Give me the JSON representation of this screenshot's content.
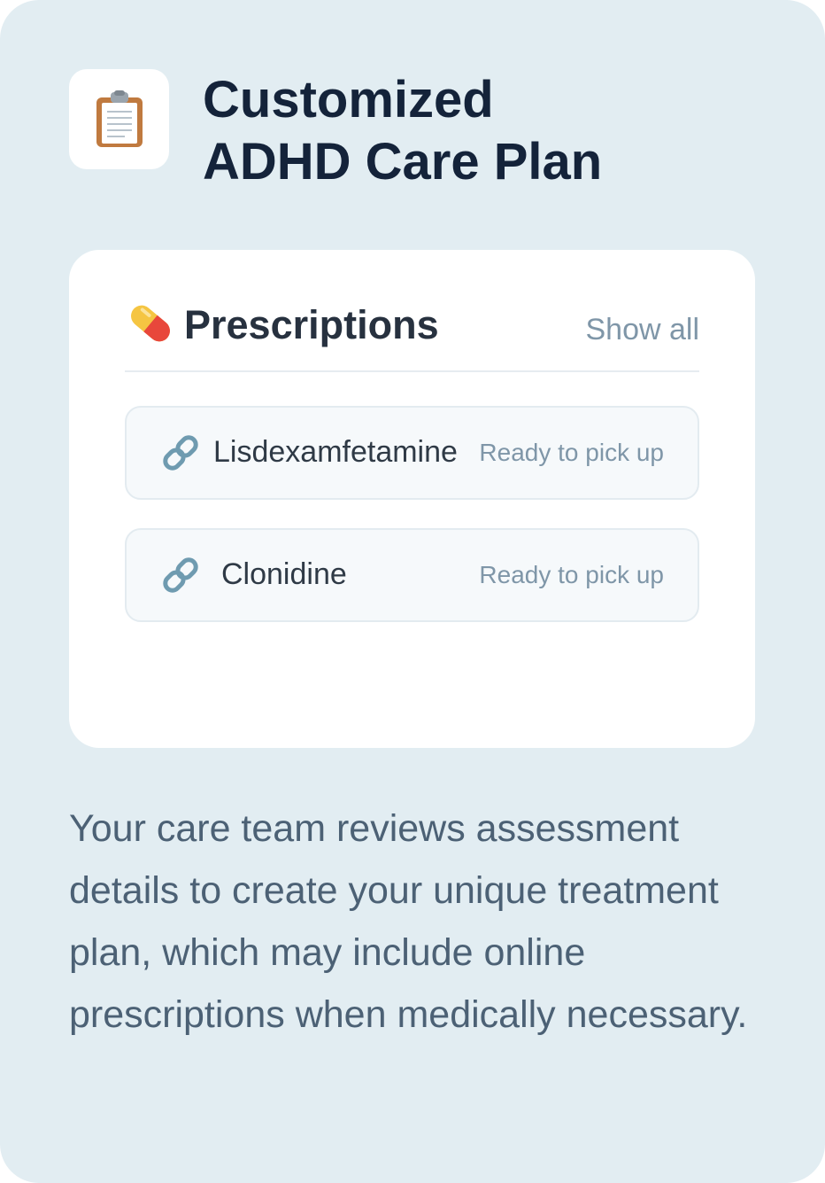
{
  "header": {
    "icon": "clipboard-icon",
    "title_line1": "Customized",
    "title_line2": "ADHD Care Plan"
  },
  "prescriptions": {
    "icon": "pill-icon",
    "title": "Prescriptions",
    "show_all_label": "Show all",
    "items": [
      {
        "icon": "link-icon",
        "name": "Lisdexamfetamine",
        "status": "Ready to pick up"
      },
      {
        "icon": "link-icon",
        "name": "Clonidine",
        "status": "Ready to pick up"
      }
    ]
  },
  "description": "Your care team reviews assessment details to create your unique treatment plan, which may include online prescriptions when medically necessary.",
  "colors": {
    "background": "#e2edf2",
    "title": "#14233a",
    "muted": "#7f96a8",
    "body_text": "#4c6175"
  }
}
